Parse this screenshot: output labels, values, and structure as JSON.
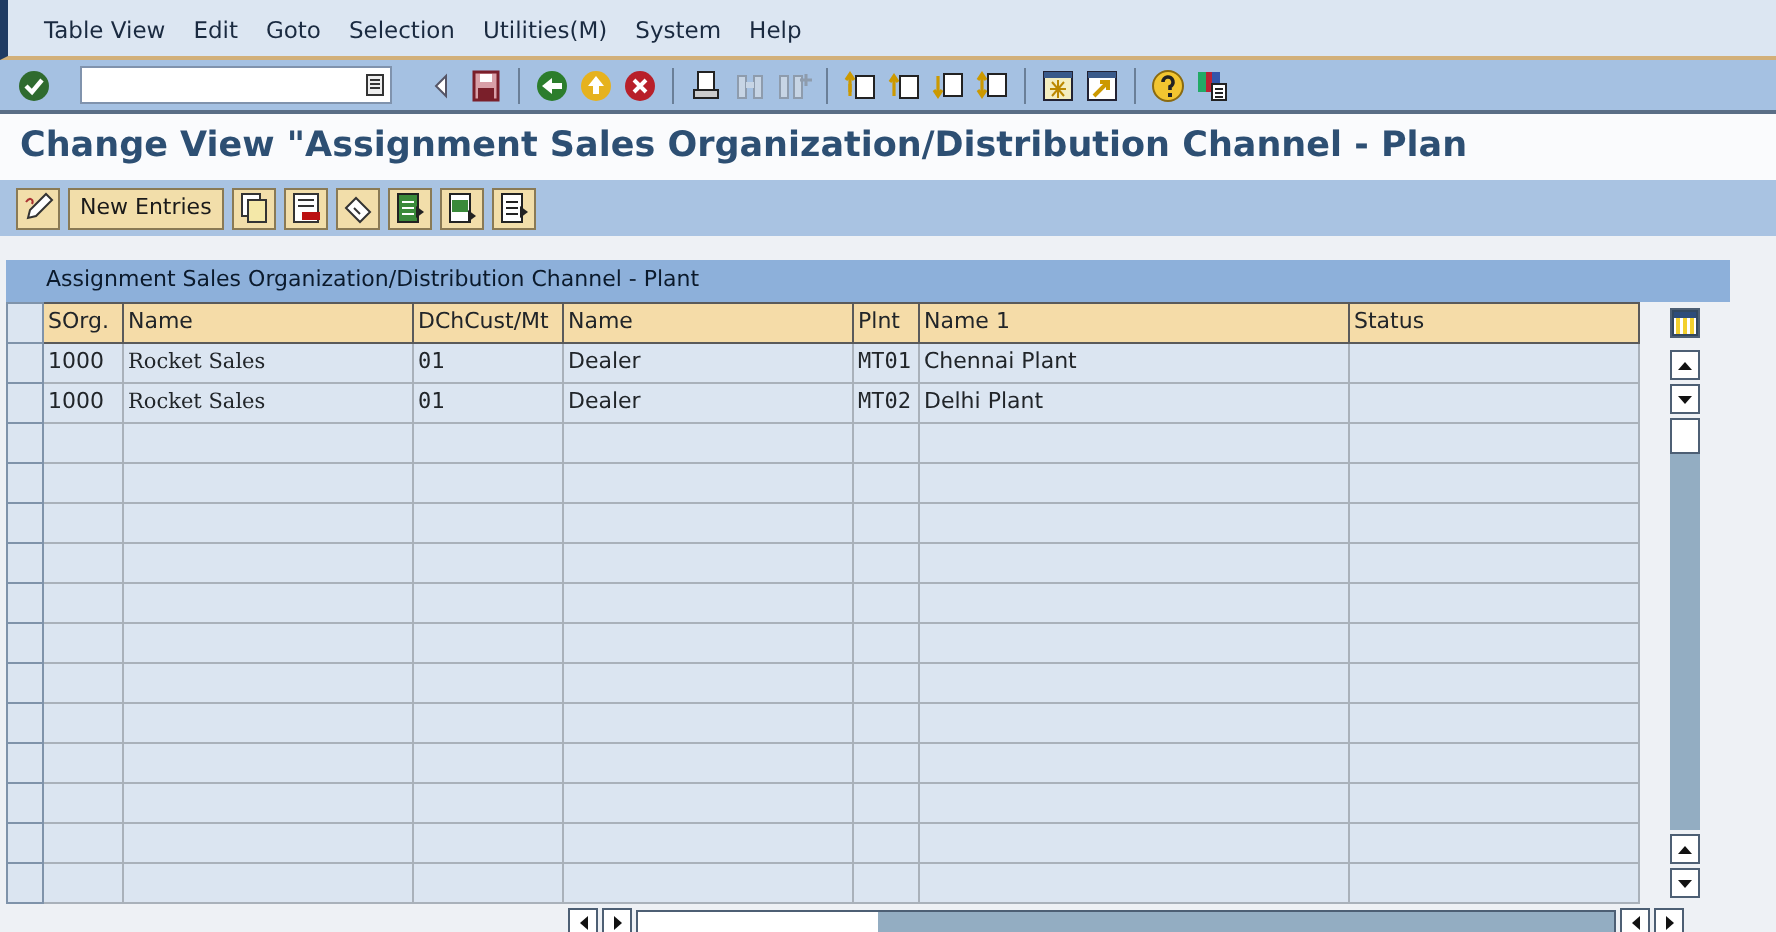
{
  "menu_bar": {
    "items": [
      "Table View",
      "Edit",
      "Goto",
      "Selection",
      "Utilities(M)",
      "System",
      "Help"
    ]
  },
  "system_toolbar": [
    {
      "kind": "enter",
      "disabled": false
    },
    {
      "kind": "command"
    },
    {
      "kind": "prev",
      "disabled": false
    },
    {
      "kind": "save",
      "disabled": false
    },
    {
      "kind": "sep"
    },
    {
      "kind": "back",
      "disabled": false
    },
    {
      "kind": "exit",
      "disabled": false
    },
    {
      "kind": "cancel",
      "disabled": false
    },
    {
      "kind": "sep"
    },
    {
      "kind": "print",
      "disabled": false
    },
    {
      "kind": "find",
      "disabled": true
    },
    {
      "kind": "findnext",
      "disabled": true
    },
    {
      "kind": "sep"
    },
    {
      "kind": "first",
      "disabled": false
    },
    {
      "kind": "up",
      "disabled": false
    },
    {
      "kind": "down",
      "disabled": false
    },
    {
      "kind": "last",
      "disabled": false
    },
    {
      "kind": "sep"
    },
    {
      "kind": "session",
      "disabled": false
    },
    {
      "kind": "shortcut",
      "disabled": false
    },
    {
      "kind": "sep"
    },
    {
      "kind": "help",
      "disabled": false
    },
    {
      "kind": "layout",
      "disabled": false
    }
  ],
  "title": "Change View \"Assignment Sales Organization/Distribution Channel - Plan",
  "app_toolbar": [
    {
      "kind": "pencil"
    },
    {
      "kind": "text",
      "label": "New Entries"
    },
    {
      "kind": "copy"
    },
    {
      "kind": "delete"
    },
    {
      "kind": "undo"
    },
    {
      "kind": "selectall"
    },
    {
      "kind": "selectblock"
    },
    {
      "kind": "deselect"
    }
  ],
  "table": {
    "title": "Assignment Sales Organization/Distribution Channel - Plant",
    "columns": [
      {
        "label": "SOrg.",
        "kind": "text"
      },
      {
        "label": "Name",
        "kind": "serif"
      },
      {
        "label": "DChCust/Mt",
        "kind": "code"
      },
      {
        "label": "Name",
        "kind": "text"
      },
      {
        "label": "Plnt",
        "kind": "code"
      },
      {
        "label": "Name 1",
        "kind": "text"
      },
      {
        "label": "Status",
        "kind": "text"
      }
    ],
    "rows": [
      [
        "1000",
        "Rocket Sales",
        "01",
        "Dealer",
        "MT01",
        "Chennai Plant"
      ],
      [
        "1000",
        "Rocket Sales",
        "01",
        "Dealer",
        "MT02",
        "Delhi Plant"
      ]
    ]
  }
}
